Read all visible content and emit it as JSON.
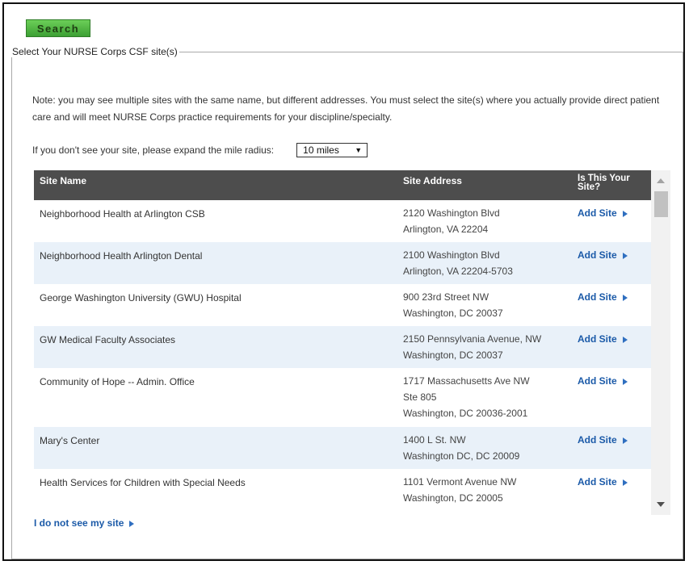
{
  "search_button": "Search",
  "fieldset_legend": "Select Your NURSE Corps CSF site(s)",
  "note": "Note: you may see multiple sites with the same name, but different addresses. You must select the site(s) where you actually provide direct patient care and will meet NURSE Corps practice requirements for your discipline/specialty.",
  "radius": {
    "label": "If you don't see your site, please expand the mile radius:",
    "selected": "10 miles"
  },
  "table": {
    "headers": {
      "site_name": "Site Name",
      "site_address": "Site Address",
      "is_this_your_site": "Is This Your Site?"
    },
    "add_label": "Add Site",
    "rows": [
      {
        "name": "Neighborhood Health at Arlington CSB",
        "address": [
          "2120 Washington Blvd",
          "Arlington, VA 22204"
        ]
      },
      {
        "name": "Neighborhood Health Arlington Dental",
        "address": [
          "2100 Washington Blvd",
          "Arlington, VA 22204-5703"
        ]
      },
      {
        "name": "George Washington University (GWU) Hospital",
        "address": [
          "900 23rd Street NW",
          "Washington, DC 20037"
        ]
      },
      {
        "name": "GW Medical Faculty Associates",
        "address": [
          "2150 Pennsylvania Avenue, NW",
          "Washington, DC 20037"
        ]
      },
      {
        "name": "Community of Hope -- Admin. Office",
        "address": [
          "1717 Massachusetts Ave NW",
          "Ste 805",
          "Washington, DC 20036-2001"
        ]
      },
      {
        "name": "Mary's Center",
        "address": [
          "1400 L St. NW",
          "Washington DC, DC 20009"
        ]
      },
      {
        "name": "Health Services for Children with Special Needs",
        "address": [
          "1101 Vermont Avenue NW",
          "Washington, DC 20005"
        ]
      }
    ]
  },
  "not_see_link": "I do not see my site",
  "colors": {
    "search_green": "#4cb340",
    "header_gray": "#4d4d4d",
    "row_stripe": "#e9f1f9",
    "link_blue": "#1b5aa8"
  },
  "icons": {
    "add_site": "triangle-right-icon",
    "dropdown": "triangle-down-icon",
    "scroll_up": "triangle-up-icon",
    "scroll_down": "triangle-down-icon"
  }
}
